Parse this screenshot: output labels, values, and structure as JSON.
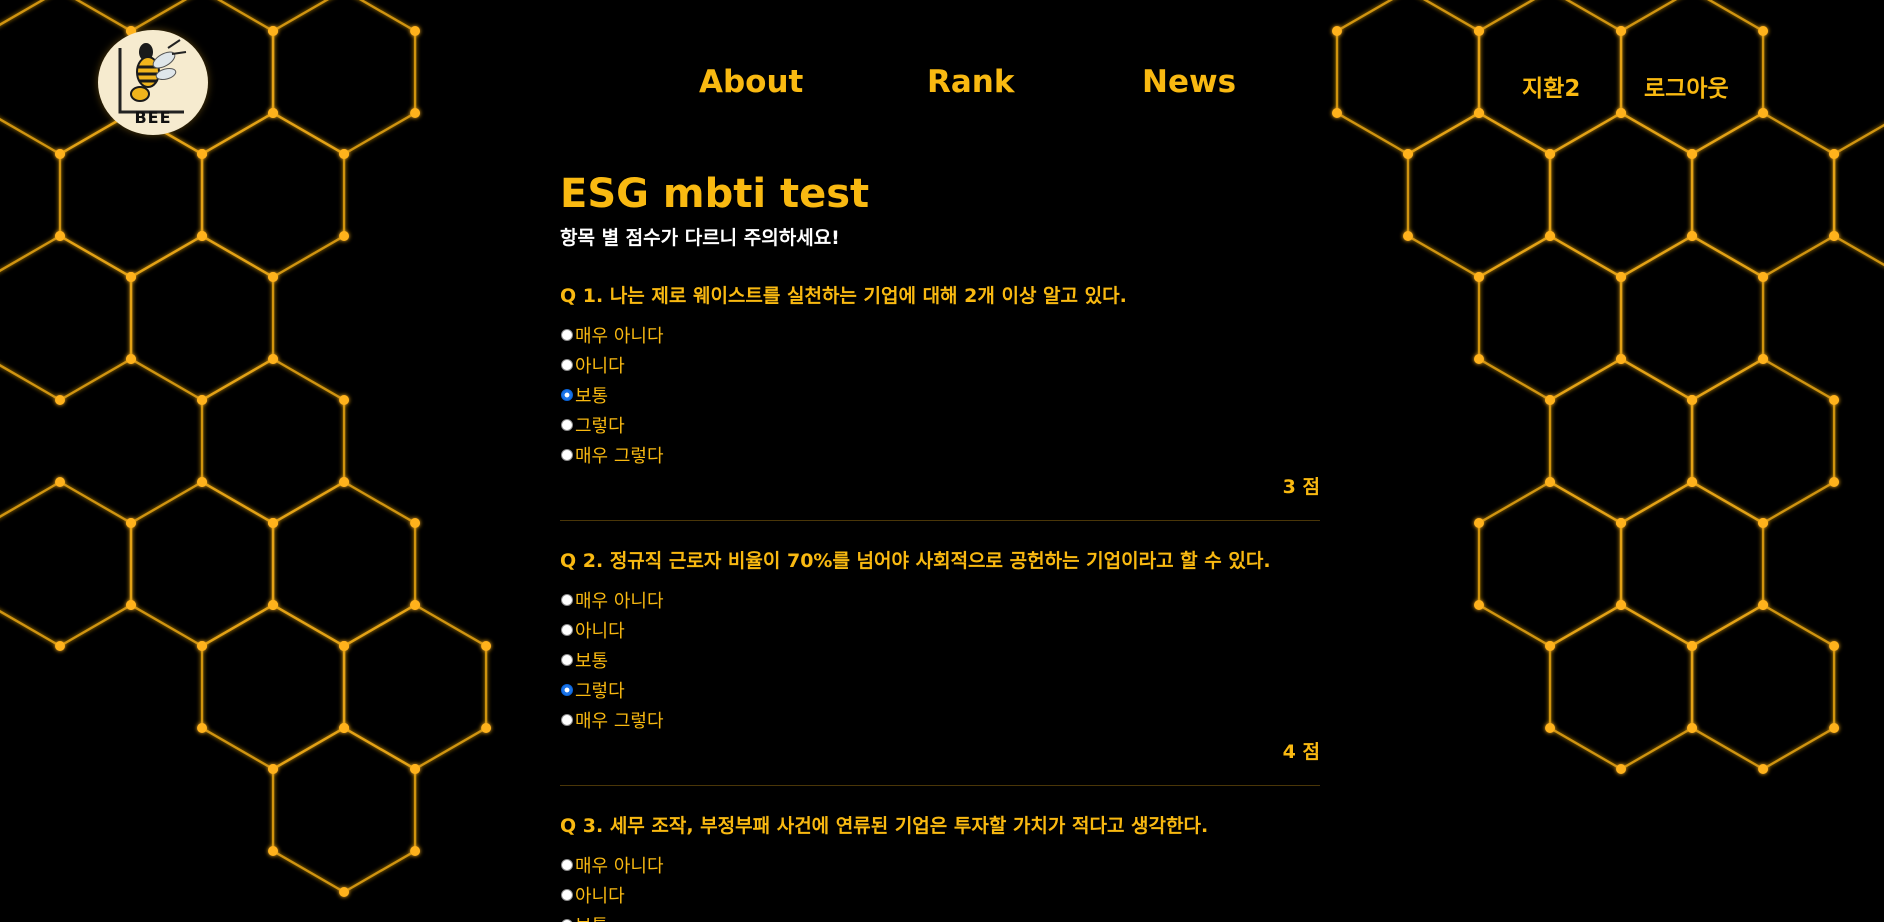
{
  "colors": {
    "background": "#000000",
    "accent": "#f9b911",
    "honeycomb_glow": "#e6a313",
    "logo_bg": "#f6ebcf",
    "divider": "#4a3608"
  },
  "logo": {
    "text": "BEE",
    "icon": "bee-logo-icon"
  },
  "nav": {
    "items": [
      {
        "label": "About"
      },
      {
        "label": "Rank"
      },
      {
        "label": "News"
      }
    ]
  },
  "user_nav": {
    "username": "지환2",
    "logout": "로그아웃"
  },
  "page": {
    "title": "ESG mbti test",
    "subtitle": "항목 별 점수가 다르니 주의하세요!"
  },
  "questions": [
    {
      "title": "Q 1. 나는 제로 웨이스트를 실천하는 기업에 대해 2개 이상 알고 있다.",
      "options": [
        {
          "label": "매우 아니다",
          "checked": false
        },
        {
          "label": "아니다",
          "checked": false
        },
        {
          "label": "보통",
          "checked": true
        },
        {
          "label": "그렇다",
          "checked": false
        },
        {
          "label": "매우 그렇다",
          "checked": false
        }
      ],
      "score": "3 점"
    },
    {
      "title": "Q 2. 정규직 근로자 비율이 70%를 넘어야 사회적으로 공헌하는 기업이라고 할 수 있다.",
      "options": [
        {
          "label": "매우 아니다",
          "checked": false
        },
        {
          "label": "아니다",
          "checked": false
        },
        {
          "label": "보통",
          "checked": false
        },
        {
          "label": "그렇다",
          "checked": true
        },
        {
          "label": "매우 그렇다",
          "checked": false
        }
      ],
      "score": "4 점"
    },
    {
      "title": "Q 3. 세무 조작, 부정부패 사건에 연류된 기업은 투자할 가치가 적다고 생각한다.",
      "options": [
        {
          "label": "매우 아니다",
          "checked": false
        },
        {
          "label": "아니다",
          "checked": false
        },
        {
          "label": "보통",
          "checked": false
        }
      ],
      "score": ""
    }
  ]
}
